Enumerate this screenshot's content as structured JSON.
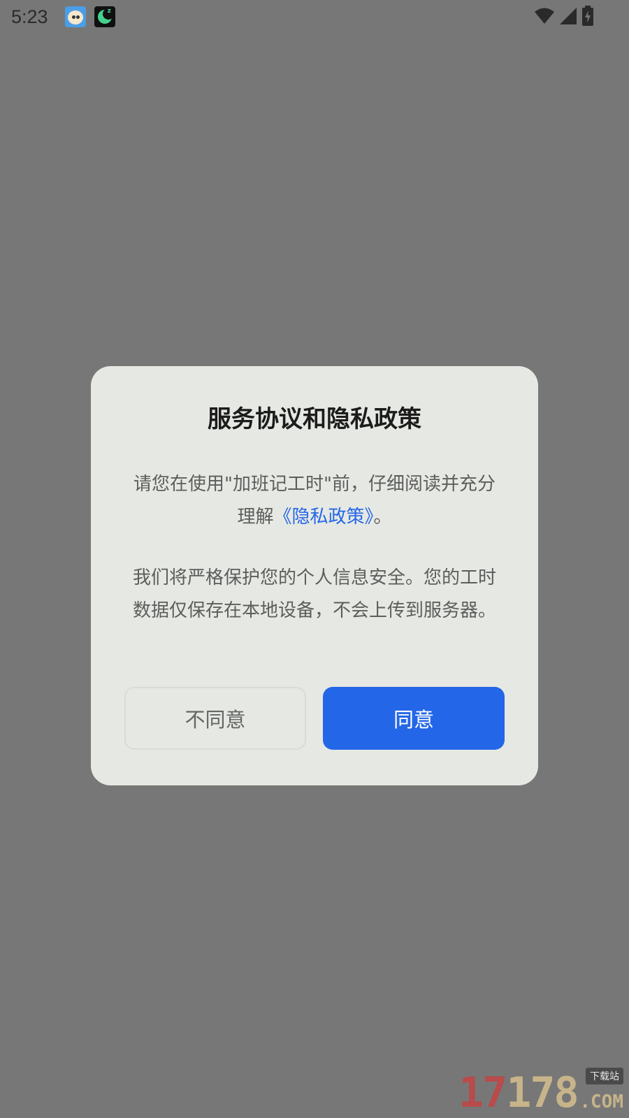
{
  "status_bar": {
    "time": "5:23",
    "icons": [
      "face-app-icon",
      "moon-app-icon",
      "wifi-icon",
      "cell-signal-icon",
      "battery-charging-icon"
    ]
  },
  "dialog": {
    "title": "服务协议和隐私政策",
    "para1_prefix": "请您在使用\"加班记工时\"前，仔细阅读并充分理解",
    "para1_link": "《隐私政策》",
    "para1_suffix": "。",
    "para2": "我们将严格保护您的个人信息安全。您的工时数据仅保存在本地设备，不会上传到服务器。",
    "disagree_label": "不同意",
    "agree_label": "同意"
  },
  "colors": {
    "overlay": "#777777",
    "dialog_bg": "#e6e9e3",
    "accent": "#2466e8",
    "link": "#2566e8"
  },
  "watermark": {
    "num_red": "17",
    "num_gold": "178",
    "tag": "下载站",
    "suffix": ".COM"
  }
}
